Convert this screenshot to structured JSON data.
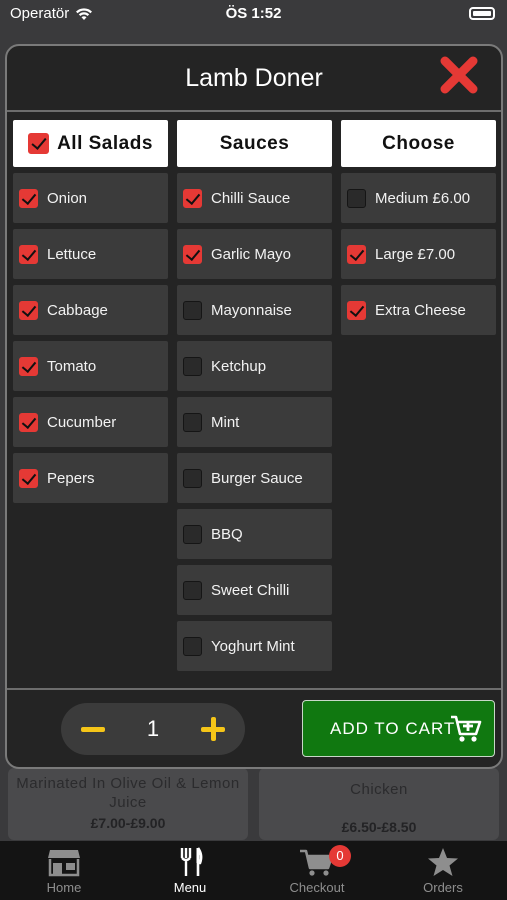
{
  "status_bar": {
    "carrier": "Operatör",
    "time": "ÖS 1:52"
  },
  "modal": {
    "title": "Lamb Doner",
    "columns": [
      {
        "header": "All Salads",
        "header_checked": true,
        "items": [
          {
            "label": "Onion",
            "checked": true
          },
          {
            "label": "Lettuce",
            "checked": true
          },
          {
            "label": "Cabbage",
            "checked": true
          },
          {
            "label": "Tomato",
            "checked": true
          },
          {
            "label": "Cucumber",
            "checked": true
          },
          {
            "label": "Pepers",
            "checked": true
          }
        ]
      },
      {
        "header": "Sauces",
        "items": [
          {
            "label": "Chilli Sauce",
            "checked": true
          },
          {
            "label": "Garlic Mayo",
            "checked": true
          },
          {
            "label": "Mayonnaise",
            "checked": false
          },
          {
            "label": "Ketchup",
            "checked": false
          },
          {
            "label": "Mint",
            "checked": false
          },
          {
            "label": "Burger Sauce",
            "checked": false
          },
          {
            "label": "BBQ",
            "checked": false
          },
          {
            "label": "Sweet Chilli",
            "checked": false
          },
          {
            "label": "Yoghurt Mint",
            "checked": false
          }
        ]
      },
      {
        "header": "Choose",
        "items": [
          {
            "label": "Medium £6.00",
            "checked": false
          },
          {
            "label": "Large £7.00",
            "checked": true
          },
          {
            "label": "Extra Cheese",
            "checked": true
          }
        ]
      }
    ],
    "quantity": "1",
    "add_to_cart_label": "ADD TO CART"
  },
  "background_cards": [
    {
      "description": "Marinated In Olive Oil & Lemon Juice",
      "price": "£7.00-£9.00"
    },
    {
      "description": "Chicken",
      "price": "£6.50-£8.50"
    }
  ],
  "tabbar": {
    "items": [
      {
        "label": "Home",
        "icon": "store-icon"
      },
      {
        "label": "Menu",
        "icon": "fork-knife-icon",
        "active": true
      },
      {
        "label": "Checkout",
        "icon": "cart-icon",
        "badge": "0"
      },
      {
        "label": "Orders",
        "icon": "star-icon"
      }
    ]
  },
  "colors": {
    "accent_red": "#e53935",
    "accent_green": "#107810",
    "accent_yellow": "#f5c518",
    "modal_bg": "#242424"
  }
}
